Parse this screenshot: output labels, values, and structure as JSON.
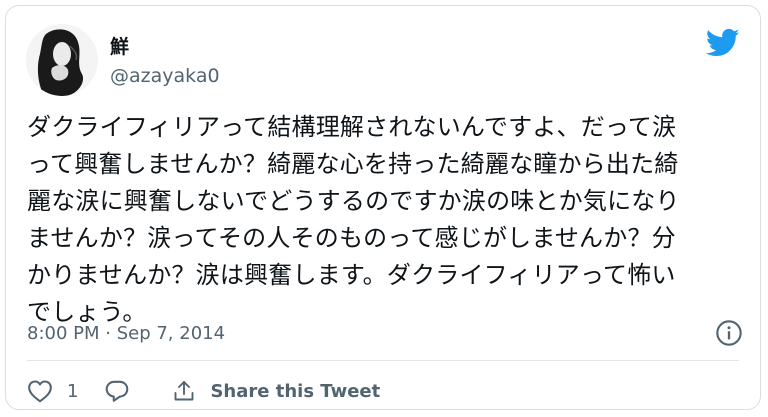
{
  "author": {
    "display_name": "鮮",
    "handle": "@azayaka0"
  },
  "tweet": {
    "lines": [
      "ダクライフィリアって結構理解されないんですよ、だって涙",
      "って興奮しませんか？綺麗な心を持った綺麗な瞳から出た綺",
      "麗な涙に興奮しないでどうするのですか涙の味とか気になり",
      "ませんか？涙ってその人そのものって感じがしませんか？分",
      "かりませんか？涙は興奮します。ダクライフィリアって怖い",
      "でしょう。"
    ],
    "timestamp": "8:00 PM · Sep 7, 2014"
  },
  "actions": {
    "like_count": "1",
    "share_label": "Share this Tweet"
  },
  "icons": {
    "logo": "twitter-bird-icon",
    "info": "info-icon",
    "like": "heart-icon",
    "reply": "reply-icon",
    "share": "share-icon"
  },
  "colors": {
    "brand": "#1d9bf0",
    "text": "#0f1419",
    "secondary": "#536471",
    "border": "#d8dee3"
  }
}
